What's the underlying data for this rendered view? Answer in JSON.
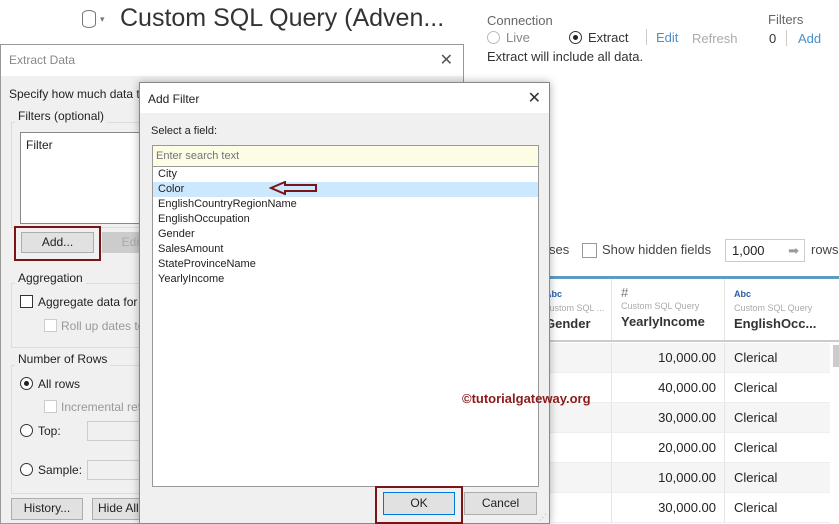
{
  "header": {
    "title": "Custom SQL Query (Adven...",
    "connection_label": "Connection",
    "live_label": "Live",
    "extract_label": "Extract",
    "edit_link": "Edit",
    "refresh_link": "Refresh",
    "extract_note": "Extract will include all data.",
    "filters_label": "Filters",
    "filters_count": "0",
    "add_link": "Add"
  },
  "grid_toolbar": {
    "partial_text": "ses",
    "show_hidden_label": "Show hidden fields",
    "rows_value": "1,000",
    "rows_label": "rows"
  },
  "table": {
    "columns": [
      {
        "type": "Abc",
        "source": "Custom SQL ...",
        "name": "Gender"
      },
      {
        "type": "#",
        "source": "Custom SQL Query",
        "name": "YearlyIncome"
      },
      {
        "type": "Abc",
        "source": "Custom SQL Query",
        "name": "EnglishOcc..."
      }
    ],
    "rows": [
      {
        "income": "10,000.00",
        "occ": "Clerical"
      },
      {
        "income": "40,000.00",
        "occ": "Clerical"
      },
      {
        "income": "30,000.00",
        "occ": "Clerical"
      },
      {
        "income": "20,000.00",
        "occ": "Clerical"
      },
      {
        "income": "10,000.00",
        "occ": "Clerical"
      },
      {
        "income": "30,000.00",
        "occ": "Clerical"
      }
    ]
  },
  "watermark": "©tutorialgateway.org",
  "extract_dialog": {
    "title": "Extract Data",
    "intro": "Specify how much data to e",
    "filters_group": "Filters (optional)",
    "filter_col": "Filter",
    "add_button": "Add...",
    "edit_button": "Edit",
    "aggregation_group": "Aggregation",
    "aggregate_label": "Aggregate data for vi",
    "rollup_label": "Roll up dates to",
    "rows_group": "Number of Rows",
    "all_rows": "All rows",
    "incremental": "Incremental refr",
    "top": "Top:",
    "sample": "Sample:",
    "history_button": "History...",
    "hide_button": "Hide All U"
  },
  "add_filter": {
    "title": "Add Filter",
    "select_label": "Select a field:",
    "search_placeholder": "Enter search text",
    "fields": [
      "City",
      "Color",
      "EnglishCountryRegionName",
      "EnglishOccupation",
      "Gender",
      "SalesAmount",
      "StateProvinceName",
      "YearlyIncome"
    ],
    "selected": "Color",
    "ok": "OK",
    "cancel": "Cancel"
  },
  "colors": {
    "accent": "#4a90c8",
    "highlight": "#7b1416",
    "selection": "#cce8ff"
  }
}
